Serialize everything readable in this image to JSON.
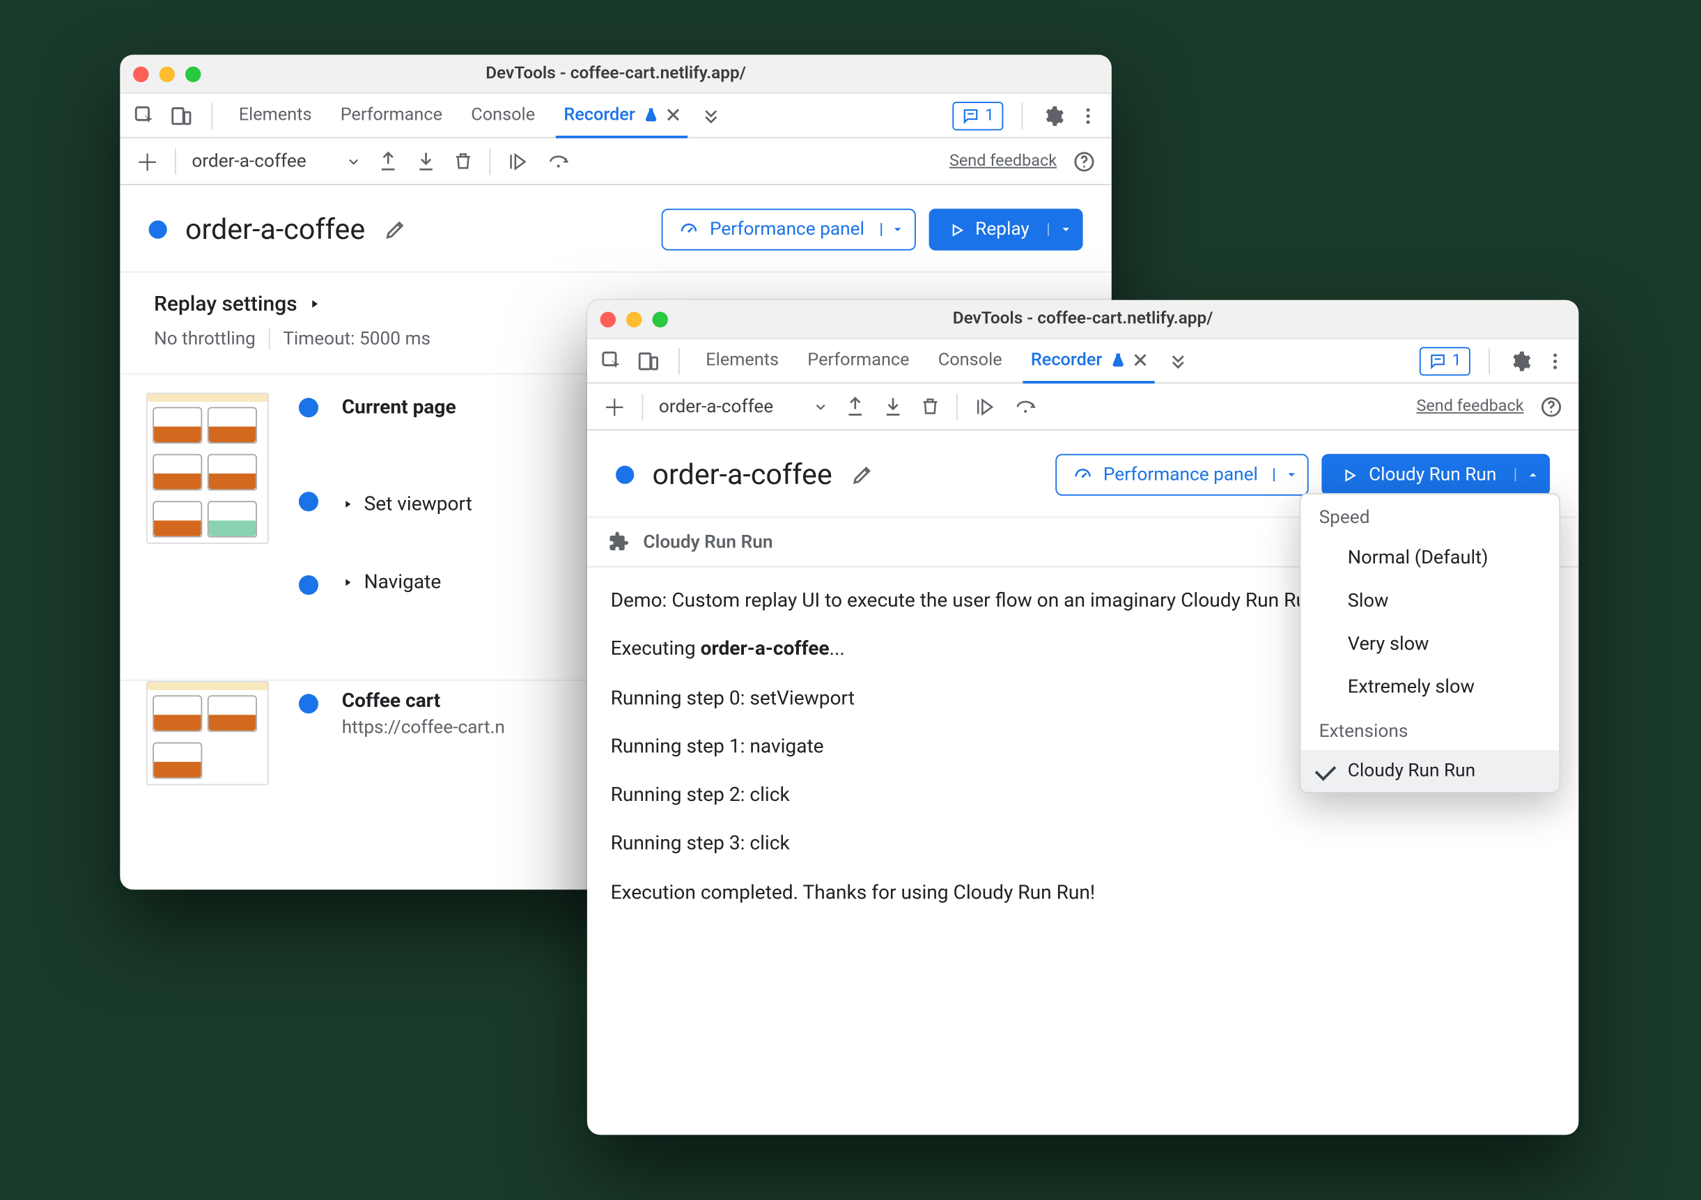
{
  "window": {
    "title": "DevTools - coffee-cart.netlify.app/"
  },
  "tabs": {
    "elements": "Elements",
    "performance": "Performance",
    "console": "Console",
    "recorder": "Recorder",
    "messages_count": "1"
  },
  "subbar": {
    "recording_select": "order-a-coffee",
    "feedback": "Send feedback"
  },
  "recorder": {
    "name": "order-a-coffee",
    "perf_panel_btn": "Performance panel",
    "replay_btn": "Replay",
    "replay_btn_ext": "Cloudy Run Run"
  },
  "replay_settings": {
    "title": "Replay settings",
    "throttling": "No throttling",
    "timeout": "Timeout: 5000 ms"
  },
  "timeline": {
    "current_page": "Current page",
    "set_viewport": "Set viewport",
    "navigate": "Navigate",
    "coffee_cart": "Coffee cart",
    "coffee_cart_url": "https://coffee-cart.n"
  },
  "dropdown": {
    "speed_head": "Speed",
    "normal": "Normal (Default)",
    "slow": "Slow",
    "very_slow": "Very slow",
    "extremely_slow": "Extremely slow",
    "ext_head": "Extensions",
    "ext_item": "Cloudy Run Run"
  },
  "custom_panel": {
    "title": "Cloudy Run Run",
    "demo": "Demo: Custom replay UI to execute the user flow on an imaginary Cloudy Run Run platform.",
    "exec_prefix": "Executing ",
    "exec_name": "order-a-coffee",
    "exec_suffix": "...",
    "step0": "Running step 0: setViewport",
    "step1": "Running step 1: navigate",
    "step2": "Running step 2: click",
    "step3": "Running step 3: click",
    "done": "Execution completed. Thanks for using Cloudy Run Run!"
  }
}
